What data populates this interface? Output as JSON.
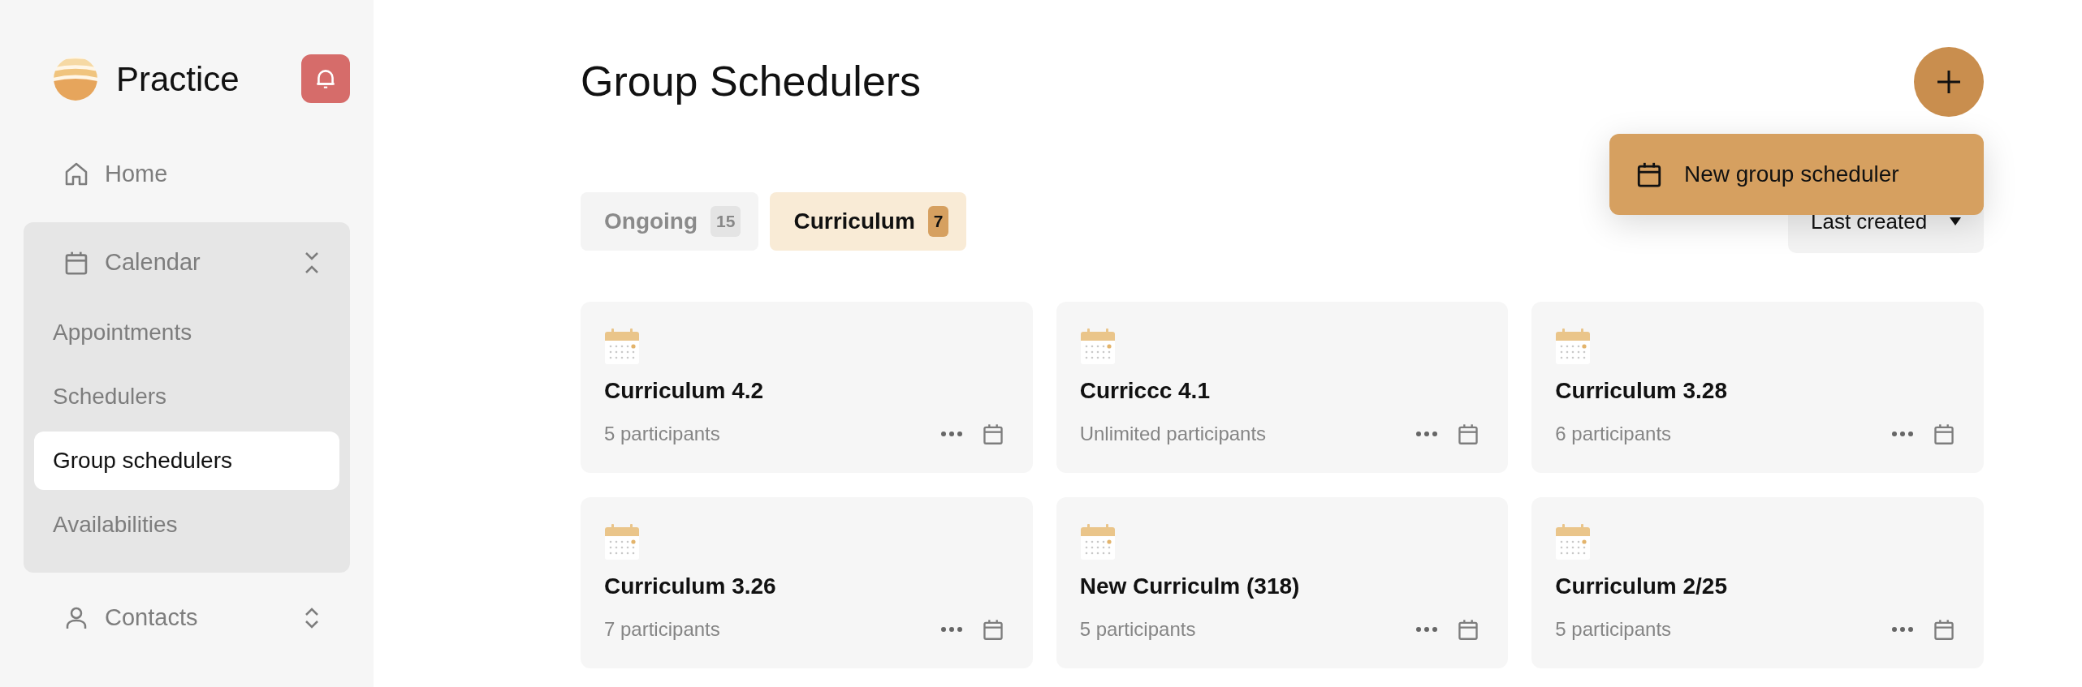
{
  "sidebar": {
    "brand": "Practice",
    "items": [
      {
        "label": "Home",
        "selected": false
      },
      {
        "label": "Calendar",
        "expanded": true,
        "children": [
          {
            "label": "Appointments",
            "selected": false
          },
          {
            "label": "Schedulers",
            "selected": false
          },
          {
            "label": "Group schedulers",
            "selected": true
          },
          {
            "label": "Availabilities",
            "selected": false
          }
        ]
      },
      {
        "label": "Contacts",
        "expanded": false
      }
    ]
  },
  "header": {
    "title": "Group Schedulers"
  },
  "menu": {
    "items": [
      {
        "label": "New group scheduler"
      }
    ]
  },
  "tabs": [
    {
      "label": "Ongoing",
      "count": "15",
      "selected": false
    },
    {
      "label": "Curriculum",
      "count": "7",
      "selected": true
    }
  ],
  "sort": {
    "value": "Last created"
  },
  "cards": [
    {
      "title": "Curriculum 4.2",
      "subtitle": "5 participants"
    },
    {
      "title": "Curriccc 4.1",
      "subtitle": "Unlimited participants"
    },
    {
      "title": "Curriculum 3.28",
      "subtitle": "6 participants"
    },
    {
      "title": "Curriculum 3.26",
      "subtitle": "7 participants"
    },
    {
      "title": "New Curriculm (318)",
      "subtitle": "5 participants"
    },
    {
      "title": "Curriculum 2/25",
      "subtitle": "5 participants"
    }
  ]
}
